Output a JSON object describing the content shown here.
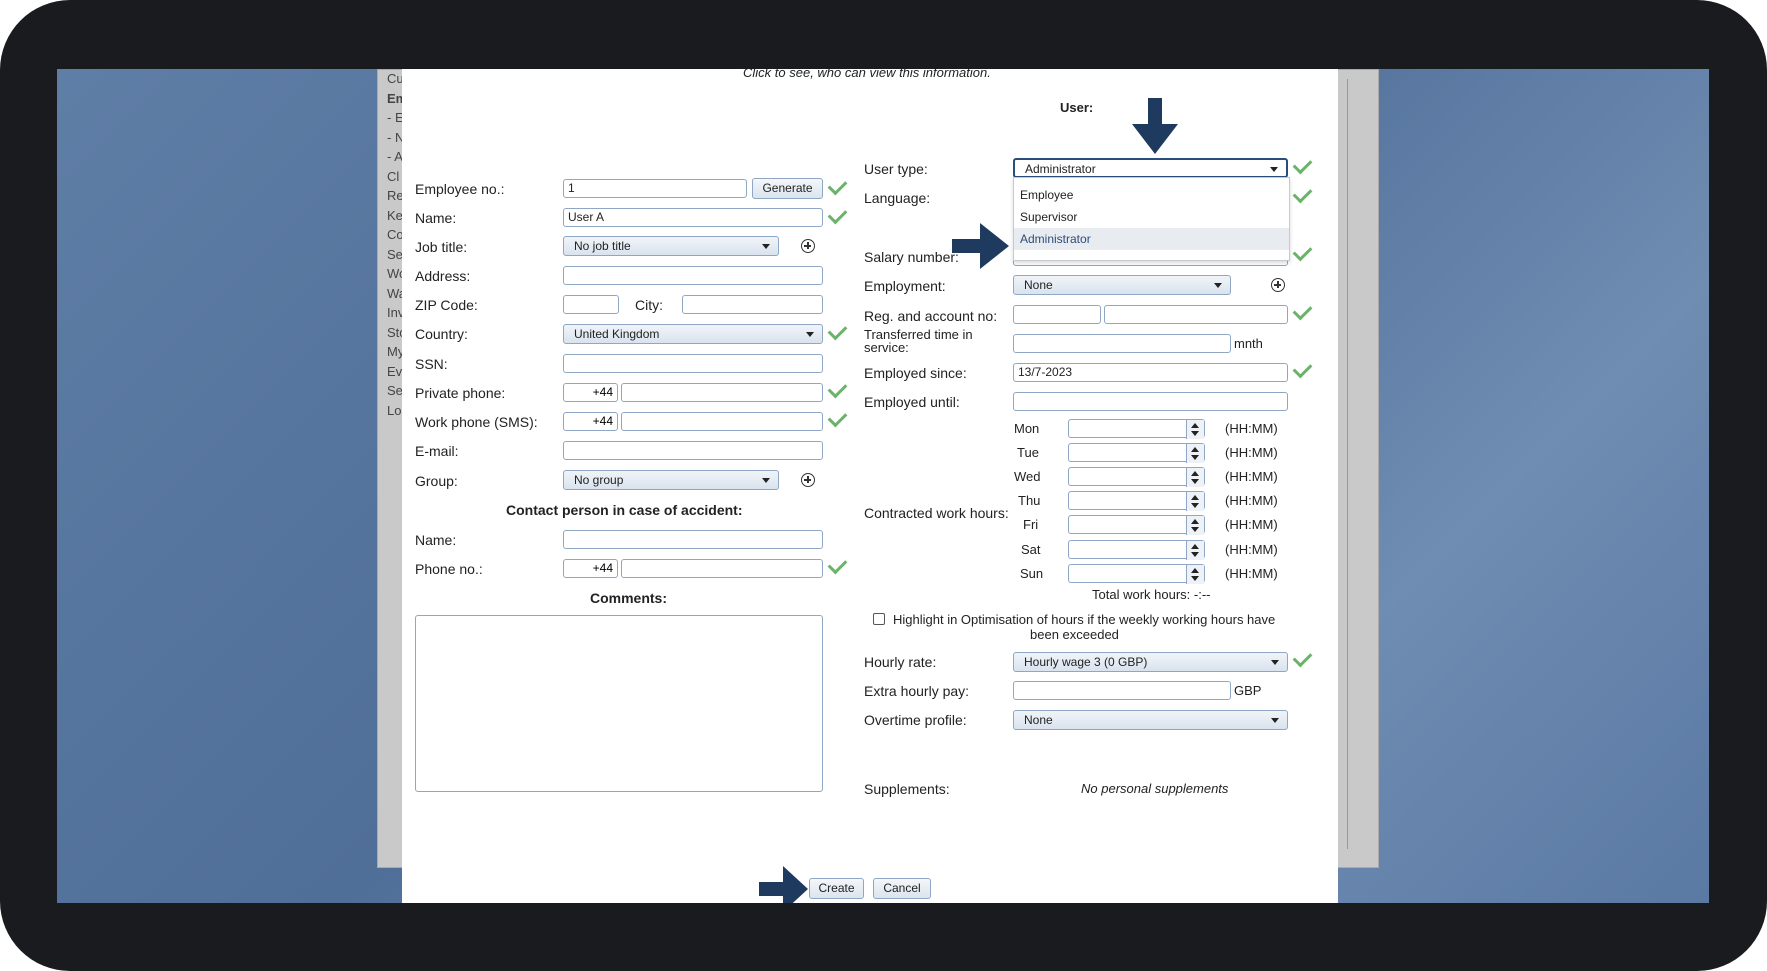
{
  "dialog": {
    "privacy_note": "Click to see, who can view this information.",
    "user_heading": "User:",
    "contact_heading": "Contact person in case of accident:",
    "comments_heading": "Comments:"
  },
  "left": {
    "employee_no": {
      "label": "Employee no.:",
      "value": "1",
      "button": "Generate"
    },
    "name": {
      "label": "Name:",
      "value": "User A"
    },
    "job_title": {
      "label": "Job title:",
      "value": "No job title"
    },
    "address": {
      "label": "Address:",
      "value": ""
    },
    "zip": {
      "label": "ZIP Code:",
      "value": ""
    },
    "city": {
      "label": "City:",
      "value": ""
    },
    "country": {
      "label": "Country:",
      "value": "United Kingdom"
    },
    "ssn": {
      "label": "SSN:",
      "value": ""
    },
    "private_phone": {
      "label": "Private phone:",
      "prefix": "+44",
      "value": ""
    },
    "work_phone": {
      "label": "Work phone (SMS):",
      "prefix": "+44",
      "value": ""
    },
    "email": {
      "label": "E-mail:",
      "value": ""
    },
    "group": {
      "label": "Group:",
      "value": "No group"
    },
    "contact_name": {
      "label": "Name:",
      "value": ""
    },
    "contact_phone": {
      "label": "Phone no.:",
      "prefix": "+44",
      "value": ""
    }
  },
  "right": {
    "user_type": {
      "label": "User type:",
      "value": "Administrator",
      "options": [
        "Employee",
        "Supervisor",
        "Administrator"
      ]
    },
    "language": {
      "label": "Language:"
    },
    "salary_number": {
      "label": "Salary number:"
    },
    "employment": {
      "label": "Employment:",
      "value": "None"
    },
    "reg_account": {
      "label": "Reg. and account no:"
    },
    "transferred": {
      "label": "Transferred time in service:",
      "unit": "mnth"
    },
    "employed_since": {
      "label": "Employed since:",
      "value": "13/7-2023"
    },
    "employed_until": {
      "label": "Employed until:",
      "value": ""
    },
    "contracted": {
      "label": "Contracted work hours:",
      "unit": "(HH:MM)",
      "days": [
        "Mon",
        "Tue",
        "Wed",
        "Thu",
        "Fri",
        "Sat",
        "Sun"
      ]
    },
    "total": "Total work hours: -:--",
    "highlight_line1": "Highlight in Optimisation of hours if the weekly working hours have",
    "highlight_line2": "been exceeded",
    "hourly_rate": {
      "label": "Hourly rate:",
      "value": "Hourly wage 3 (0 GBP)"
    },
    "extra_pay": {
      "label": "Extra hourly pay:",
      "unit": "GBP"
    },
    "overtime": {
      "label": "Overtime profile:",
      "value": "None"
    },
    "supplements": {
      "label": "Supplements:",
      "value": "No personal supplements"
    }
  },
  "footer": {
    "create": "Create",
    "cancel": "Cancel"
  },
  "background_sidebar": [
    "Cu",
    "Em",
    "- E",
    "- N",
    "- A",
    "Cl",
    "Re",
    "Ke",
    "Co",
    "Se",
    "Wo",
    "Wa",
    "Inv",
    "Sto",
    "My",
    "Ev",
    "Se",
    "Lo"
  ],
  "colors": {
    "check": "#6bb36b",
    "arrow": "#1f3a5f",
    "accent": "#2b4d7a"
  }
}
